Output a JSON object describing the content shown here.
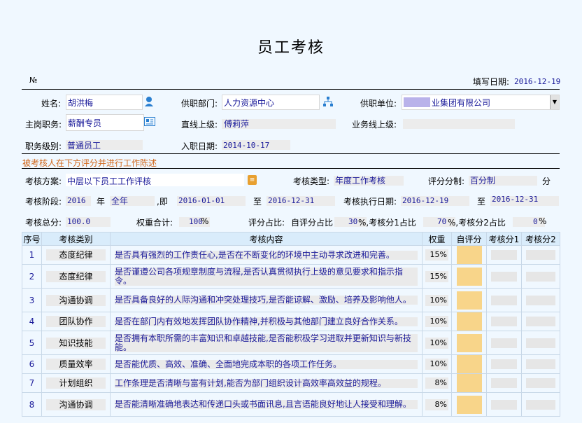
{
  "title": "员工考核",
  "no_label": "№",
  "fill_date_label": "填写日期:",
  "fill_date": "2016-12-19",
  "name_label": "姓名:",
  "name": "胡洪梅",
  "dept_label": "供职部门:",
  "dept": "人力资源中心",
  "unit_label": "供职单位:",
  "unit": "业集团有限公司",
  "position_label": "主岗职务:",
  "position": "薪酬专员",
  "superior_label": "直线上级:",
  "superior": "傅莉萍",
  "biz_superior_label": "业务线上级:",
  "biz_superior": "",
  "level_label": "职务级别:",
  "level": "普通员工",
  "hire_date_label": "入职日期:",
  "hire_date": "2014-10-17",
  "notice": "被考核人在下方评分并进行工作陈述",
  "scheme_label": "考核方案:",
  "scheme": "中层以下员工工作评核",
  "type_label": "考核类型:",
  "type": "年度工作考核",
  "score_split_label": "评分分制:",
  "score_split": "百分制",
  "score_split_unit": "分",
  "stage_label": "考核阶段:",
  "stage_year": "2016",
  "year_word": "年",
  "stage_period": "全年",
  "ji_word": ",即",
  "stage_from": "2016-01-01",
  "to_word": "至",
  "stage_to": "2016-12-31",
  "exec_label": "考核执行日期:",
  "exec_from": "2016-12-19",
  "exec_to_word": "至",
  "exec_to": "2016-12-31",
  "total_label": "考核总分:",
  "total": "100.0",
  "weight_sum_label": "权重合计:",
  "weight_sum": "100",
  "pct": "%",
  "ratio_label": "评分占比:",
  "self_ratio_label": "自评分占比",
  "self_ratio": "30",
  "r1_label": "%,考核分1占比",
  "r1": "70",
  "r2_label": "%,考核分2占比",
  "r2": "0",
  "table": {
    "headers": [
      "序号",
      "考核类别",
      "考核内容",
      "权重",
      "自评分",
      "考核分1",
      "考核分2"
    ],
    "rows": [
      {
        "no": "1",
        "category": "态度纪律",
        "content": "是否具有强烈的工作责任心,是否在不断变化的环境中主动寻求改进和完善。",
        "weight": "15%"
      },
      {
        "no": "2",
        "category": "态度纪律",
        "content": "是否谨遵公司各项规章制度与流程,是否认真贯彻执行上级的意见要求和指示指令。",
        "weight": "15%"
      },
      {
        "no": "3",
        "category": "沟通协调",
        "content": "是否具备良好的人际沟通和冲突处理技巧,是否能谅解、激励、培养及影响他人。",
        "weight": "10%"
      },
      {
        "no": "4",
        "category": "团队协作",
        "content": "是否在部门内有效地发挥团队协作精神,并积极与其他部门建立良好合作关系。",
        "weight": "10%"
      },
      {
        "no": "5",
        "category": "知识技能",
        "content": "是否拥有本职所需的丰富知识和卓越技能,是否能积极学习进取并更新知识与新技能。",
        "weight": "10%"
      },
      {
        "no": "6",
        "category": "质量效率",
        "content": "是否能优质、高效、准确、全面地完成本职的各项工作任务。",
        "weight": "10%"
      },
      {
        "no": "7",
        "category": "计划组织",
        "content": "工作条理是否清晰与富有计划,能否为部门组织设计高效率高效益的规程。",
        "weight": "8%"
      },
      {
        "no": "8",
        "category": "沟通协调",
        "content": "是否能清晰准确地表达和传递口头或书面讯息,且言语能良好地让人接受和理解。",
        "weight": "8%"
      }
    ]
  }
}
